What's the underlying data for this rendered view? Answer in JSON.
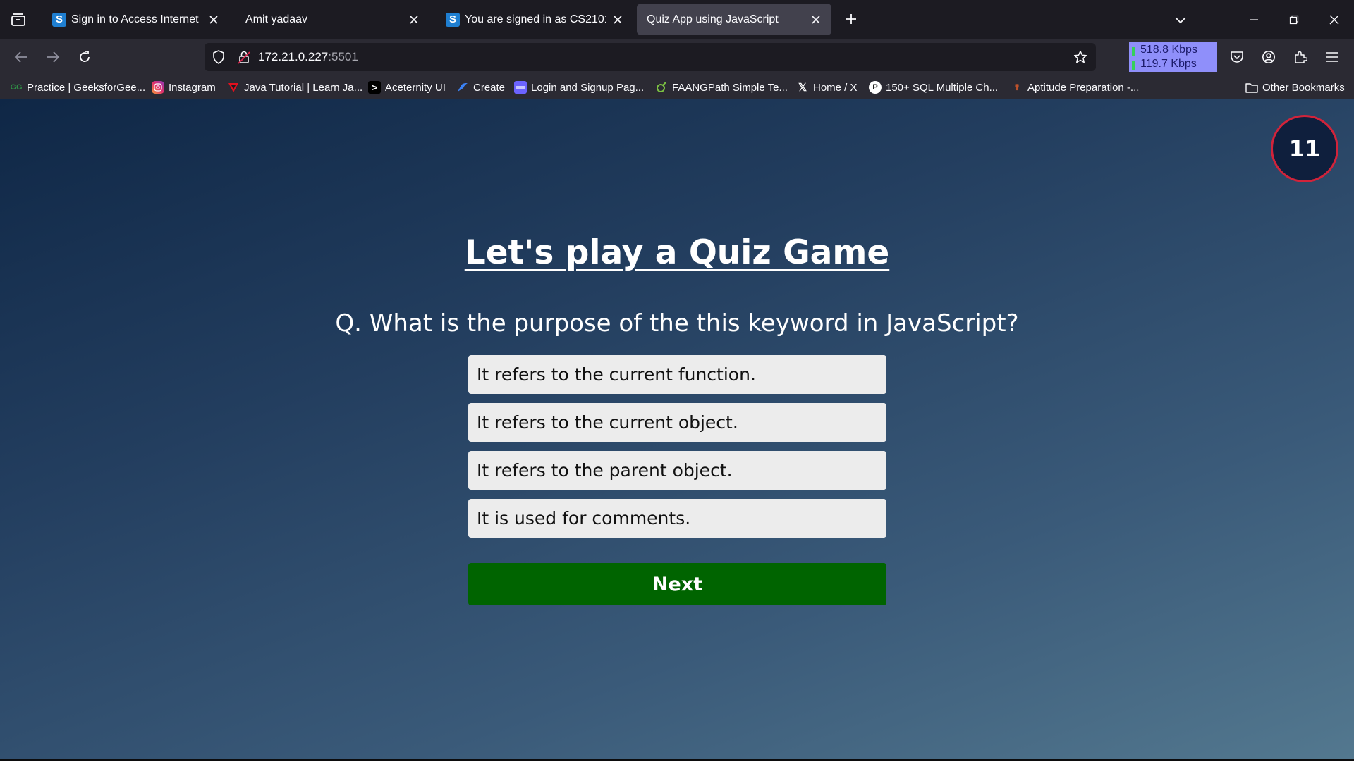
{
  "browser": {
    "tabs": [
      {
        "title": "Sign in to Access Internet",
        "favicon": "S",
        "active": false
      },
      {
        "title": "Amit yadaav",
        "favicon": "",
        "active": false
      },
      {
        "title": "You are signed in as CS21015",
        "favicon": "S",
        "active": false
      },
      {
        "title": "Quiz App using JavaScript",
        "favicon": "",
        "active": true
      }
    ],
    "url_host": "172.21.0.227",
    "url_port": ":5501",
    "speed": {
      "down": "518.8 Kbps",
      "up": "119.7 Kbps"
    },
    "bookmarks": [
      {
        "label": "Practice | GeeksforGee...",
        "icon": "geeksforgeeks-icon"
      },
      {
        "label": "Instagram",
        "icon": "instagram-icon"
      },
      {
        "label": "Java Tutorial | Learn Ja...",
        "icon": "java-tutorial-icon"
      },
      {
        "label": "Aceternity UI",
        "icon": "aceternity-icon"
      },
      {
        "label": "Create",
        "icon": "create-icon"
      },
      {
        "label": "Login and Signup Pag...",
        "icon": "login-page-icon"
      },
      {
        "label": "FAANGPath Simple Te...",
        "icon": "faangpath-icon"
      },
      {
        "label": "Home / X",
        "icon": "x-icon"
      },
      {
        "label": "150+ SQL Multiple Ch...",
        "icon": "sql-icon"
      },
      {
        "label": "Aptitude Preparation -...",
        "icon": "aptitude-icon"
      }
    ],
    "other_bookmarks": "Other Bookmarks",
    "colors": {
      "tab_strip": "#1c1b22",
      "toolbar": "#2b2a33",
      "active_tab": "#42414d"
    }
  },
  "quiz": {
    "timer": "11",
    "heading": "Let's play a Quiz Game",
    "question": "Q. What is the purpose of the this keyword in JavaScript?",
    "answers": [
      "It refers to the current function.",
      "It refers to the current object.",
      "It refers to the parent object.",
      "It is used for comments."
    ],
    "next_label": "Next",
    "colors": {
      "next_button": "#006400",
      "timer_border": "#d2233a",
      "answer_bg": "#ececec"
    }
  }
}
